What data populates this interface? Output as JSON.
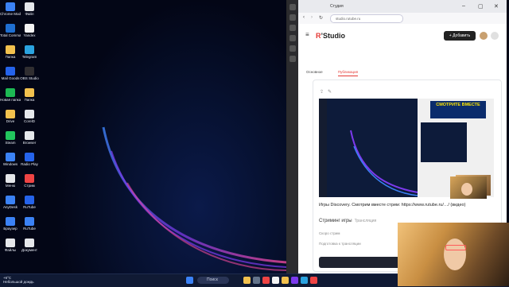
{
  "desktop": {
    "icons": [
      {
        "label": "Chrome Mode",
        "color": "#3b82f6"
      },
      {
        "label": "Файл",
        "color": "#e5e7eb"
      },
      {
        "label": "Total Commander",
        "color": "#1f6fd1"
      },
      {
        "label": "Yandex",
        "color": "#f4f4f4"
      },
      {
        "label": "Папка",
        "color": "#f2c14e"
      },
      {
        "label": "Telegram",
        "color": "#2aa3e0"
      },
      {
        "label": "Mail Goods",
        "color": "#2563eb"
      },
      {
        "label": "OBS Studio",
        "color": "#302e31"
      },
      {
        "label": "Новая папка",
        "color": "#1db954"
      },
      {
        "label": "Папка",
        "color": "#f2c14e"
      },
      {
        "label": "Drive",
        "color": "#f2c14e"
      },
      {
        "label": "CorelD",
        "color": "#e5e7eb"
      },
      {
        "label": "Steam",
        "color": "#22c55e"
      },
      {
        "label": "Browser",
        "color": "#e5e7eb"
      },
      {
        "label": "Windows",
        "color": "#3b82f6"
      },
      {
        "label": "Radio Play",
        "color": "#2563eb"
      },
      {
        "label": "Меню",
        "color": "#e5e7eb"
      },
      {
        "label": "Стрим",
        "color": "#ef4444"
      },
      {
        "label": "AnyDesk",
        "color": "#3b82f6"
      },
      {
        "label": "RuTube",
        "color": "#2563eb"
      },
      {
        "label": "Браузер",
        "color": "#3b82f6"
      },
      {
        "label": "RuTube",
        "color": "#3b82f6"
      },
      {
        "label": "Файлы",
        "color": "#e5e7eb"
      },
      {
        "label": "Документ",
        "color": "#e5e7eb"
      }
    ]
  },
  "taskbar": {
    "weather_temp": "+6°C",
    "weather_text": "Небольшой дождь",
    "search_placeholder": "Поиск",
    "items": [
      {
        "name": "start-icon",
        "color": "#3b82f6"
      },
      {
        "name": "files-icon",
        "color": "#f2c14e"
      },
      {
        "name": "app-icon",
        "color": "#64748b"
      },
      {
        "name": "app-icon",
        "color": "#ef4444"
      },
      {
        "name": "yandex-icon",
        "color": "#f4f4f4"
      },
      {
        "name": "app-icon",
        "color": "#f2c14e"
      },
      {
        "name": "app-icon",
        "color": "#7c3aed"
      },
      {
        "name": "telegram-icon",
        "color": "#2aa3e0"
      },
      {
        "name": "app-icon",
        "color": "#ef4444"
      }
    ]
  },
  "browser": {
    "tab_title": "Студия",
    "url": "studio.rutube.ru",
    "app": {
      "logo_prefix": "R",
      "logo_main": "Studio",
      "add_button": "+ Добавить"
    },
    "tabs": [
      "Основное",
      "Публикация"
    ],
    "active_tab_index": 1,
    "card": {
      "ad_text": "СМОТРИТЕ ВМЕСТЕ",
      "description": "Игры Discovery. Смотрим вместе стрим: https://www.rutube.ru/…/ (видео)",
      "title": "Стриминг игры",
      "title_meta": "Трансляция",
      "line1": "Скоро стрим",
      "line2": "Подготовка к трансляции",
      "action_button": "Запустить трансляцию"
    }
  },
  "colors": {
    "accent": "#e53935",
    "dark": "#222222"
  }
}
